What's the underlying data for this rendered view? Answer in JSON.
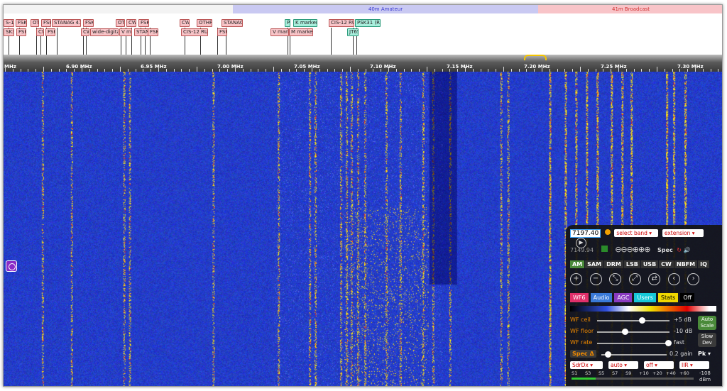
{
  "bands": [
    {
      "label": "40m Amateur",
      "color": "#c9c9f2",
      "text_color": "#3a3ad0"
    },
    {
      "label": "41m Broadcast",
      "color": "#f8c4c8",
      "text_color": "#d03030"
    }
  ],
  "labels": [
    {
      "text": "S-12",
      "row": 1,
      "col": 0
    },
    {
      "text": "FSK",
      "row": 1,
      "col": 1
    },
    {
      "text": "OT",
      "row": 1,
      "col": 2
    },
    {
      "text": "FSK",
      "row": 1,
      "col": 3
    },
    {
      "text": "STANAG 41!",
      "row": 1,
      "col": 4
    },
    {
      "text": "FSK",
      "row": 1,
      "col": 5
    },
    {
      "text": "OTH",
      "row": 1,
      "col": 6
    },
    {
      "text": "CW",
      "row": 1,
      "col": 7
    },
    {
      "text": "FSK",
      "row": 1,
      "col": 8
    },
    {
      "text": "CW",
      "row": 1,
      "col": 9
    },
    {
      "text": "OTHR",
      "row": 1,
      "col": 10
    },
    {
      "text": "STANAG",
      "row": 1,
      "col": 11
    },
    {
      "text": "P",
      "row": 1,
      "col": 12
    },
    {
      "text": "K marker (3)",
      "row": 1,
      "col": 13
    },
    {
      "text": "CIS-12 RUS",
      "row": 1,
      "col": 14
    },
    {
      "text": "PSK31 (R2)",
      "row": 1,
      "col": 15
    },
    {
      "text": "SK32",
      "row": 2,
      "col": 0
    },
    {
      "text": "FSK",
      "row": 2,
      "col": 1
    },
    {
      "text": "CW",
      "row": 2,
      "col": 2
    },
    {
      "text": "FSK",
      "row": 2,
      "col": 3
    },
    {
      "text": "CW",
      "row": 2,
      "col": 4
    },
    {
      "text": "wide-digita",
      "row": 2,
      "col": 5
    },
    {
      "text": "V ma",
      "row": 2,
      "col": 6
    },
    {
      "text": "STANA",
      "row": 2,
      "col": 7
    },
    {
      "text": "FSK",
      "row": 2,
      "col": 8
    },
    {
      "text": "CIS-12 RUS",
      "row": 2,
      "col": 9
    },
    {
      "text": "FSK",
      "row": 2,
      "col": 10
    },
    {
      "text": "V marke",
      "row": 2,
      "col": 11
    },
    {
      "text": "M marker",
      "row": 2,
      "col": 12
    },
    {
      "text": "JT65",
      "row": 2,
      "col": 13
    }
  ],
  "scale": {
    "left_label": "MHz",
    "freqs": [
      "6.90 MHz",
      "6.95 MHz",
      "7.00 MHz",
      "7.05 MHz",
      "7.10 MHz",
      "7.15 MHz",
      "7.20 MHz",
      "7.25 MHz",
      "7.30 MHz"
    ]
  },
  "panel": {
    "freq_value": "7197.40",
    "select_band": "select band",
    "extension": "extension",
    "sub_freq": "7149.94",
    "spec_label": "Spec",
    "modes": [
      "AM",
      "SAM",
      "DRM",
      "LSB",
      "USB",
      "CW",
      "NBFM",
      "IQ"
    ],
    "active_mode": "AM",
    "tabs": [
      {
        "label": "WF6",
        "color": "#e0306a"
      },
      {
        "label": "Audio",
        "color": "#3a7ad8"
      },
      {
        "label": "AGC",
        "color": "#8a3ac0"
      },
      {
        "label": "Users",
        "color": "#16c8d8"
      },
      {
        "label": "Stats",
        "color": "#f0d800"
      },
      {
        "label": "Off",
        "color": "#000000"
      }
    ],
    "wf_ceil": {
      "label": "WF ceil",
      "value": "+5 dB",
      "level": 0.62
    },
    "wf_floor": {
      "label": "WF floor",
      "value": "-10 dB",
      "level": 0.38
    },
    "wf_rate": {
      "label": "WF rate",
      "value": "fast",
      "level": 0.98
    },
    "auto_scale": "Auto Scale",
    "slow_dev": "Slow Dev",
    "spec_delta": {
      "label": "Spec Δ",
      "value": "0.2 gain",
      "level": 0.1
    },
    "pk": "Pk",
    "bottom_selects": [
      "SdrDx",
      "auto",
      "off",
      "IIR"
    ],
    "smeter_ticks": [
      "S1",
      "S3",
      "S5",
      "S7",
      "S9",
      "+10",
      "+20",
      "+40",
      "+60"
    ],
    "smeter_reading": "-108",
    "smeter_unit": "dBm"
  },
  "colors": {
    "waterfall_base": "#2030c8",
    "signal_yellow": "#f4d400",
    "signal_red": "#e02020"
  }
}
